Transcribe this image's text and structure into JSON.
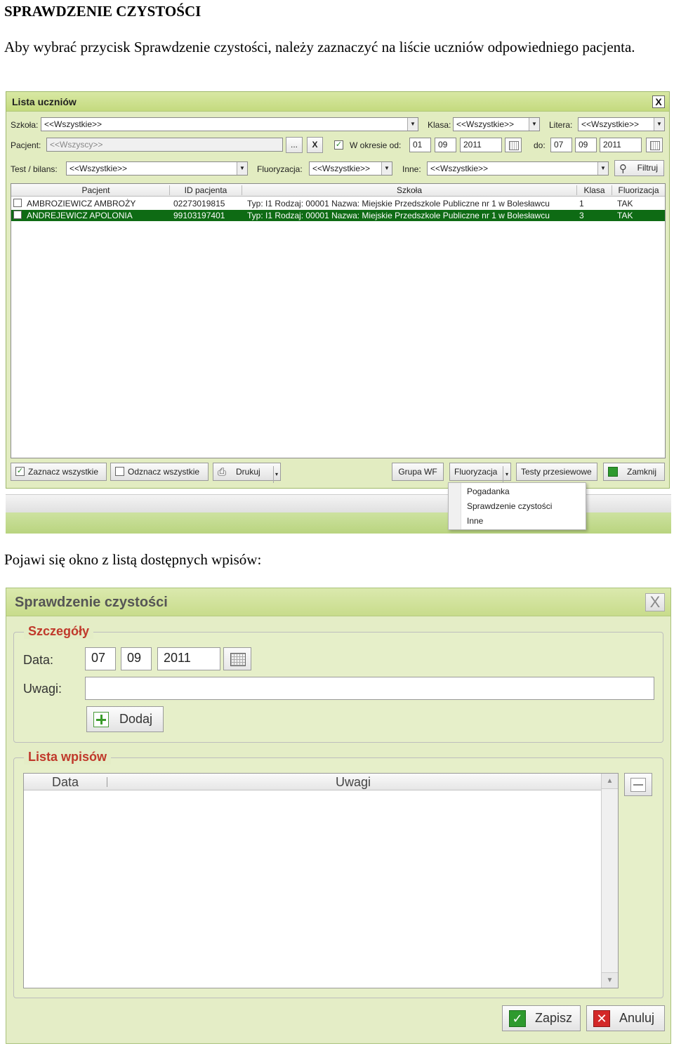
{
  "doc": {
    "heading": "SPRAWDZENIE CZYSTOŚCI",
    "para1": "Aby wybrać  przycisk Sprawdzenie czystości, należy zaznaczyć na liście uczniów odpowiedniego pacjenta.",
    "para2": "Pojawi się okno z listą dostępnych wpisów:"
  },
  "win1": {
    "title": "Lista uczniów",
    "close": "X",
    "filters": {
      "szkola_label": "Szkoła:",
      "szkola_value": "<<Wszystkie>>",
      "klasa_label": "Klasa:",
      "klasa_value": "<<Wszystkie>>",
      "litera_label": "Litera:",
      "litera_value": "<<Wszystkie>>",
      "pacjent_label": "Pacjent:",
      "pacjent_value": "<<Wszyscy>>",
      "dots": "...",
      "clear": "X",
      "okres_label": "W okresie od:",
      "od_d": "01",
      "od_m": "09",
      "od_y": "2011",
      "do_label": "do:",
      "do_d": "07",
      "do_m": "09",
      "do_y": "2011",
      "test_label": "Test / bilans:",
      "test_value": "<<Wszystkie>>",
      "fluor_label": "Fluoryzacja:",
      "fluor_value": "<<Wszystkie>>",
      "inne_label": "Inne:",
      "inne_value": "<<Wszystkie>>",
      "filtruj": "Filtruj"
    },
    "grid": {
      "headers": [
        "Pacjent",
        "ID pacjenta",
        "Szkoła",
        "Klasa",
        "Fluorizacja"
      ],
      "rows": [
        {
          "pacjent": "AMBROZIEWICZ AMBROŻY",
          "id": "02273019815",
          "szkola": "Typ: I1 Rodzaj: 00001 Nazwa: Miejskie Przedszkole Publiczne nr 1 w Bolesławcu",
          "klasa": "1",
          "fluor": "TAK"
        },
        {
          "pacjent": "ANDREJEWICZ APOLONIA",
          "id": "99103197401",
          "szkola": "Typ: I1 Rodzaj: 00001 Nazwa: Miejskie Przedszkole Publiczne nr 1 w Bolesławcu",
          "klasa": "3",
          "fluor": "TAK"
        }
      ]
    },
    "buttons": {
      "zaznacz": "Zaznacz wszystkie",
      "odznacz": "Odznacz wszystkie",
      "drukuj": "Drukuj",
      "grupa": "Grupa WF",
      "fluor": "Fluoryzacja",
      "testy": "Testy przesiewowe",
      "zamknij": "Zamknij"
    },
    "menu": [
      "Pogadanka",
      "Sprawdzenie czystości",
      "Inne"
    ]
  },
  "win2": {
    "title": "Sprawdzenie czystości",
    "close": "X",
    "szczegoly": "Szczegóły",
    "data_label": "Data:",
    "data_d": "07",
    "data_m": "09",
    "data_y": "2011",
    "uwagi_label": "Uwagi:",
    "dodaj": "Dodaj",
    "lista": "Lista wpisów",
    "col_data": "Data",
    "col_uwagi": "Uwagi",
    "zapisz": "Zapisz",
    "anuluj": "Anuluj"
  }
}
